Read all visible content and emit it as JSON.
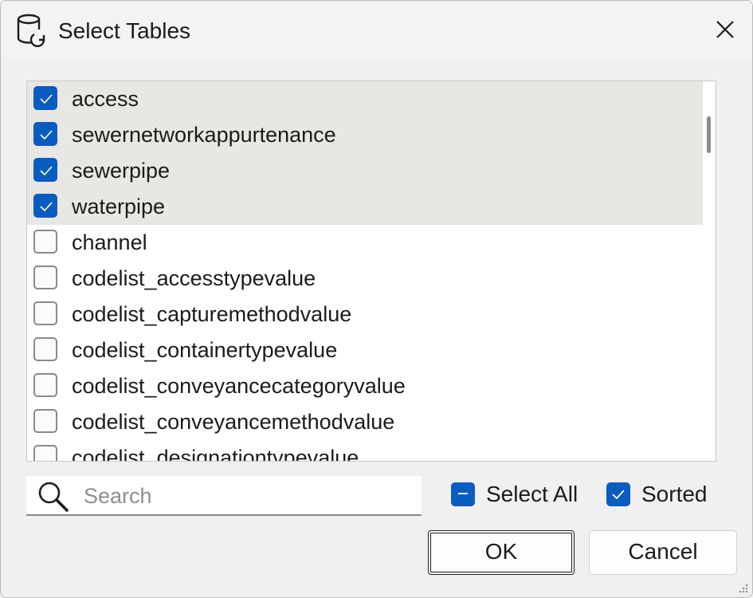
{
  "window": {
    "title": "Select Tables",
    "icon": "database-refresh-icon",
    "close_icon": "close-icon"
  },
  "table_list": {
    "items": [
      {
        "label": "access",
        "checked": true
      },
      {
        "label": "sewernetworkappurtenance",
        "checked": true
      },
      {
        "label": "sewerpipe",
        "checked": true
      },
      {
        "label": "waterpipe",
        "checked": true
      },
      {
        "label": "channel",
        "checked": false
      },
      {
        "label": "codelist_accesstypevalue",
        "checked": false
      },
      {
        "label": "codelist_capturemethodvalue",
        "checked": false
      },
      {
        "label": "codelist_containertypevalue",
        "checked": false
      },
      {
        "label": "codelist_conveyancecategoryvalue",
        "checked": false
      },
      {
        "label": "codelist_conveyancemethodvalue",
        "checked": false
      },
      {
        "label": "codelist_designationtypevalue",
        "checked": false
      }
    ]
  },
  "search": {
    "value": "",
    "placeholder": "Search",
    "icon": "search-icon"
  },
  "options": {
    "select_all_label": "Select All",
    "select_all_state": "indeterminate",
    "sorted_label": "Sorted",
    "sorted_state": "checked"
  },
  "buttons": {
    "ok_label": "OK",
    "cancel_label": "Cancel"
  },
  "colors": {
    "accent": "#0b5cc1",
    "selected_row": "#e9e7e4"
  }
}
